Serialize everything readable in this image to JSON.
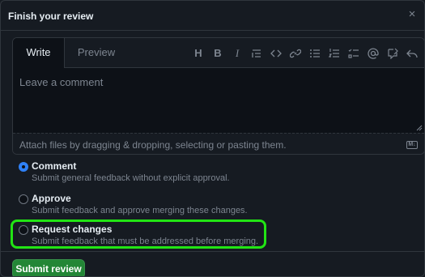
{
  "dialog": {
    "title": "Finish your review",
    "close_icon": "x-icon"
  },
  "editor": {
    "tabs": [
      {
        "label": "Write",
        "selected": true
      },
      {
        "label": "Preview",
        "selected": false
      }
    ],
    "toolbar": [
      {
        "name": "heading",
        "glyph": "H"
      },
      {
        "name": "bold",
        "glyph": "B"
      },
      {
        "name": "italic",
        "glyph": "I"
      },
      {
        "name": "quote",
        "glyph": "quote"
      },
      {
        "name": "code",
        "glyph": "code"
      },
      {
        "name": "link",
        "glyph": "link"
      },
      {
        "name": "unordered-list",
        "glyph": "ul"
      },
      {
        "name": "ordered-list",
        "glyph": "ol"
      },
      {
        "name": "task-list",
        "glyph": "task"
      },
      {
        "name": "mention",
        "glyph": "@"
      },
      {
        "name": "reference",
        "glyph": "ref"
      },
      {
        "name": "reply",
        "glyph": "reply"
      }
    ],
    "placeholder": "Leave a comment",
    "attach_text": "Attach files by dragging & dropping, selecting or pasting them.",
    "markdown_badge": "M↓"
  },
  "review_options": [
    {
      "title": "Comment",
      "description": "Submit general feedback without explicit approval.",
      "checked": true
    },
    {
      "title": "Approve",
      "description": "Submit feedback and approve merging these changes.",
      "checked": false
    },
    {
      "title": "Request changes",
      "description": "Submit feedback that must be addressed before merging.",
      "checked": false
    }
  ],
  "submit_label": "Submit review",
  "colors": {
    "background": "#161b22",
    "border": "#30363d",
    "accent": "#2f81f7",
    "submit": "#238636",
    "highlight": "#22e414"
  }
}
